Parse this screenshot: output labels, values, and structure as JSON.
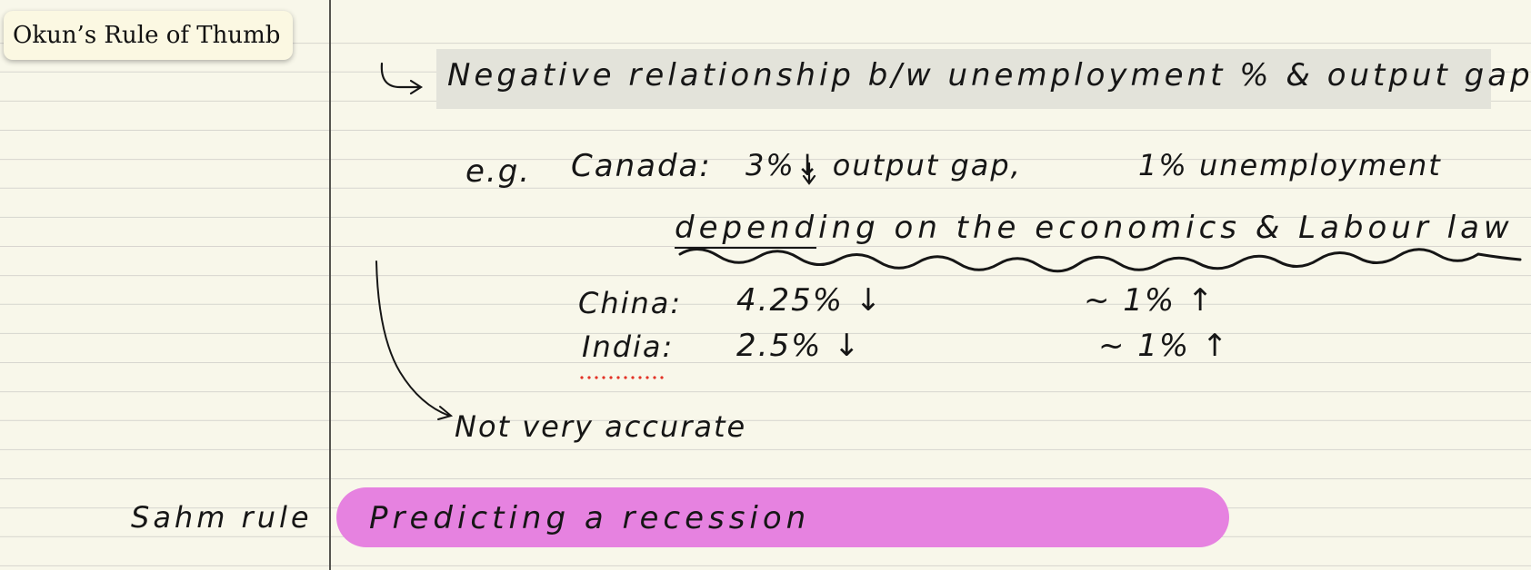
{
  "title": "Okun’s Rule of Thumb",
  "notes": {
    "definition": "Negative relationship b/w unemployment % & output gap.",
    "example_prefix": "e.g.",
    "canada_label": "Canada:",
    "canada_output": "3%↓ output gap,",
    "canada_unemployment": "1% unemployment",
    "dependency": "depending on the economics & Labour law",
    "china_label": "China:",
    "china_output": "4.25% ↓",
    "china_unemployment": "~ 1% ↑",
    "india_label": "India:",
    "india_output": "2.5% ↓",
    "india_unemployment": "~ 1% ↑",
    "accuracy_note": "Not very accurate",
    "sahm_label": "Sahm rule",
    "sahm_text": "Predicting a recession"
  },
  "colors": {
    "paper": "#f8f7ea",
    "ink": "#161616",
    "gray_highlight": "#e3e3da",
    "pink_highlight": "#e682e0",
    "spellcheck_red": "#e33327"
  }
}
